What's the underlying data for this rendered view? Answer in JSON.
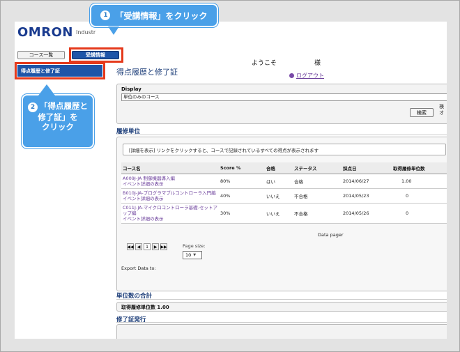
{
  "header": {
    "logo_text": "OMRON",
    "tagline": "Industr"
  },
  "nav": {
    "course_list_label": "コース一覧",
    "course_info_label": "受講情報"
  },
  "sidebar": {
    "items": [
      {
        "label": "得点履歴と修了証"
      }
    ]
  },
  "user": {
    "welcome": "ようこそ",
    "honorific": "様",
    "logout": "ログアウト"
  },
  "main": {
    "title": "得点履歴と修了証",
    "display": {
      "label": "Display",
      "selected": "単位のみのコース",
      "search_button": "検索",
      "extra_label": "検\nオ"
    },
    "history": {
      "section_title": "履修単位",
      "hint": "[詳細を表示] リンクをクリックすると、コースで記録されているすべての得点が表示されます",
      "columns": [
        "コース名",
        "Score %",
        "合格",
        "ステータス",
        "採点日",
        "取得履修単位数"
      ],
      "rows": [
        {
          "course": "A009J-JA  制御機器導入編",
          "link": "イベント詳細の表示",
          "score": "80%",
          "pass": "はい",
          "status": "合格",
          "date": "2014/06/27",
          "credits": "1.00"
        },
        {
          "course": "B010J-JA-プログラマブルコントローラ入門編",
          "link": "イベント詳細の表示",
          "score": "40%",
          "pass": "いいえ",
          "status": "不合格",
          "date": "2014/05/23",
          "credits": "0"
        },
        {
          "course": "C011J-JA-マイクロコントローラ基礎-セットアップ編",
          "link": "イベント詳細の表示",
          "score": "30%",
          "pass": "いいえ",
          "status": "不合格",
          "date": "2014/05/26",
          "credits": "0"
        }
      ],
      "pager_label": "Data pager",
      "current_page": "1",
      "page_size_label": "Page size:",
      "page_size": "10",
      "export_label": "Export Data to:"
    },
    "totals": {
      "section_title": "単位数の合計",
      "text": "取得履修単位数 1.00"
    },
    "certificate": {
      "section_title": "修了証発行"
    }
  },
  "callouts": {
    "c1_num": "1",
    "c1_text": "「受講情報」をクリック",
    "c2_num": "2",
    "c2_text_line1": "「得点履歴と",
    "c2_text_line2": "修了証」を",
    "c2_text_line3": "クリック"
  },
  "colors": {
    "brand": "#1a3b8f",
    "accent": "#1e55a8",
    "highlight": "#e53a1c",
    "callout": "#4aa0e8"
  }
}
